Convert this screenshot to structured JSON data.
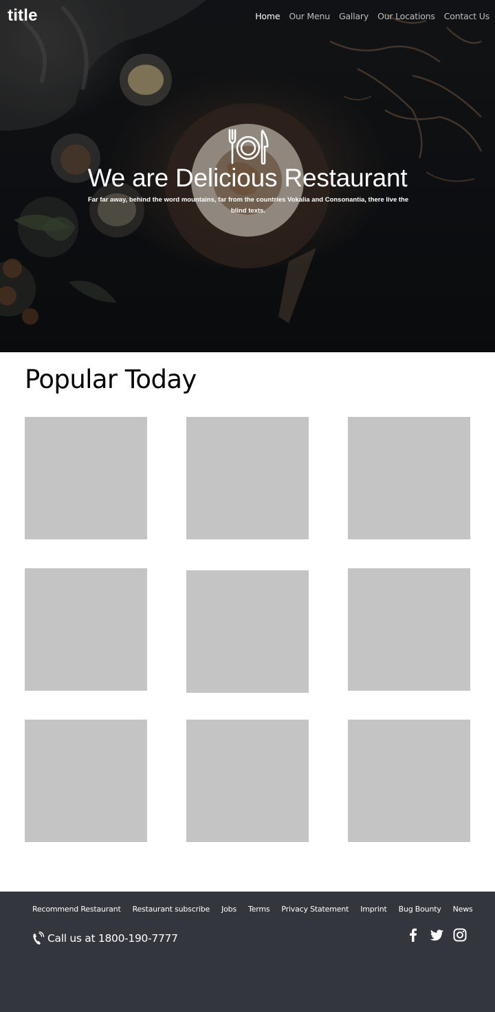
{
  "header": {
    "logo": "title",
    "nav": [
      "Home",
      "Our Menu",
      "Gallary",
      "Our Locations",
      "Contact Us"
    ],
    "active_nav": "Home"
  },
  "hero": {
    "icon": "plate-cutlery-icon",
    "title": "We are Delicious Restaurant",
    "subtitle": "Far far away, behind the word mountains, far from the countries Vokalia and Consonantia, there live the blind texts."
  },
  "popular": {
    "title": "Popular Today",
    "tile_color": "#c4c4c4"
  },
  "footer": {
    "links": [
      "Recommend Restaurant",
      "Restaurant subscribe",
      "Jobs",
      "Terms",
      "Privacy Statement",
      "Imprint",
      "Bug Bounty",
      "News"
    ],
    "phone_icon": "phone-ringing-icon",
    "phone_text": "Call us at 1800-190-7777",
    "social_icons": [
      "facebook-icon",
      "twitter-icon",
      "instagram-icon"
    ],
    "background": "#33363d"
  }
}
